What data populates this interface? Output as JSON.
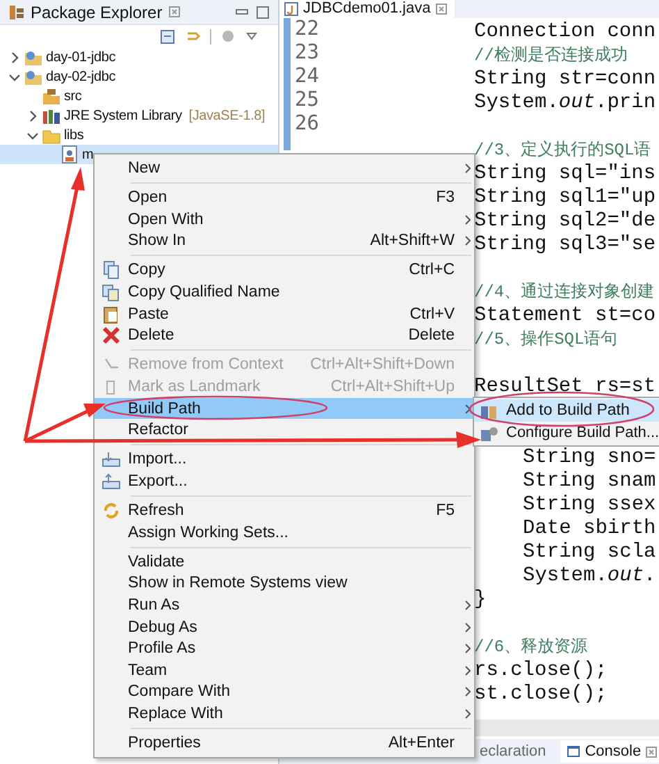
{
  "explorer": {
    "title": "Package Explorer",
    "tree": [
      {
        "label": "day-01-jdbc",
        "kind": "project",
        "expanded": false,
        "selected": false
      },
      {
        "label": "day-02-jdbc",
        "kind": "project",
        "expanded": true,
        "selected": false,
        "children": [
          {
            "label": "src",
            "kind": "source",
            "selected": false
          },
          {
            "label": "JRE System Library",
            "suffix": "[JavaSE-1.8]",
            "kind": "library",
            "expanded": false,
            "selected": false
          },
          {
            "label": "libs",
            "kind": "folder",
            "expanded": true,
            "selected": false,
            "children": [
              {
                "label": "m",
                "kind": "jar",
                "selected": true
              }
            ]
          }
        ]
      }
    ]
  },
  "editor": {
    "tab": "JDBCdemo01.java",
    "line_numbers": [
      "22",
      "23",
      "24",
      "25",
      "26"
    ],
    "lines": [
      {
        "kind": "code",
        "text": "Connection conn"
      },
      {
        "kind": "comment",
        "text": "//检测是否连接成功"
      },
      {
        "kind": "code",
        "text": "String str=conn"
      },
      {
        "kind": "code",
        "text": "System.*out*.prin"
      },
      {
        "kind": "blank"
      },
      {
        "kind": "comment",
        "text": "//3、定义执行的SQL语"
      },
      {
        "kind": "code",
        "text": "String sql=\"ins"
      },
      {
        "kind": "code",
        "text": "String sql1=\"up"
      },
      {
        "kind": "code",
        "text": "String sql2=\"de"
      },
      {
        "kind": "code",
        "text": "String sql3=\"se"
      },
      {
        "kind": "blank"
      },
      {
        "kind": "comment",
        "text": "//4、通过连接对象创建"
      },
      {
        "kind": "code",
        "text": "Statement st=co"
      },
      {
        "kind": "comment",
        "text": "//5、操作SQL语句"
      },
      {
        "kind": "blank"
      },
      {
        "kind": "code",
        "text": "ResultSet rs=st"
      },
      {
        "kind": "blank"
      },
      {
        "kind": "blank"
      },
      {
        "kind": "nested",
        "text": "String sno="
      },
      {
        "kind": "nested",
        "text": "String snam"
      },
      {
        "kind": "nested",
        "text": "String ssex"
      },
      {
        "kind": "nested",
        "text": "Date sbirth"
      },
      {
        "kind": "nested",
        "text": "String scla"
      },
      {
        "kind": "nested",
        "text": "System.*out*."
      },
      {
        "kind": "code",
        "text": "}"
      },
      {
        "kind": "blank"
      },
      {
        "kind": "comment",
        "text": "//6、释放资源"
      },
      {
        "kind": "code",
        "text": "rs.close();"
      },
      {
        "kind": "code",
        "text": "st.close();"
      }
    ]
  },
  "bottom_tabs": [
    {
      "label": "eclaration",
      "selected": false
    },
    {
      "label": "Console",
      "selected": true
    }
  ],
  "context_menu": {
    "groups": [
      {
        "items": [
          {
            "label": "New",
            "submenu": true,
            "disabled": false,
            "selected": false
          }
        ]
      },
      {
        "items": [
          {
            "label": "Open",
            "shortcut": "F3",
            "submenu": false,
            "disabled": false,
            "selected": false
          },
          {
            "label": "Open With",
            "submenu": true,
            "disabled": false,
            "selected": false
          },
          {
            "label": "Show In",
            "shortcut": "Alt+Shift+W",
            "submenu": true,
            "disabled": false,
            "selected": false
          }
        ]
      },
      {
        "items": [
          {
            "label": "Copy",
            "shortcut": "Ctrl+C",
            "submenu": false,
            "disabled": false,
            "selected": false
          },
          {
            "label": "Copy Qualified Name",
            "submenu": false,
            "disabled": false,
            "selected": false
          },
          {
            "label": "Paste",
            "shortcut": "Ctrl+V",
            "submenu": false,
            "disabled": false,
            "selected": false
          },
          {
            "label": "Delete",
            "shortcut": "Delete",
            "submenu": false,
            "disabled": false,
            "selected": false
          }
        ]
      },
      {
        "items": [
          {
            "label": "Remove from Context",
            "shortcut": "Ctrl+Alt+Shift+Down",
            "submenu": false,
            "disabled": true,
            "selected": false
          },
          {
            "label": "Mark as Landmark",
            "shortcut": "Ctrl+Alt+Shift+Up",
            "submenu": false,
            "disabled": true,
            "selected": false
          },
          {
            "label": "Build Path",
            "submenu": true,
            "disabled": false,
            "selected": true
          },
          {
            "label": "Refactor",
            "submenu": false,
            "disabled": false,
            "selected": false
          }
        ]
      },
      {
        "items": [
          {
            "label": "Import...",
            "submenu": false,
            "disabled": false,
            "selected": false
          },
          {
            "label": "Export...",
            "submenu": false,
            "disabled": false,
            "selected": false
          }
        ]
      },
      {
        "items": [
          {
            "label": "Refresh",
            "shortcut": "F5",
            "submenu": false,
            "disabled": false,
            "selected": false
          },
          {
            "label": "Assign Working Sets...",
            "submenu": false,
            "disabled": false,
            "selected": false
          }
        ]
      },
      {
        "items": [
          {
            "label": "Validate",
            "submenu": false,
            "disabled": false,
            "selected": false
          },
          {
            "label": "Show in Remote Systems view",
            "submenu": false,
            "disabled": false,
            "selected": false
          },
          {
            "label": "Run As",
            "submenu": true,
            "disabled": false,
            "selected": false
          },
          {
            "label": "Debug As",
            "submenu": true,
            "disabled": false,
            "selected": false
          },
          {
            "label": "Profile As",
            "submenu": true,
            "disabled": false,
            "selected": false
          },
          {
            "label": "Team",
            "submenu": true,
            "disabled": false,
            "selected": false
          },
          {
            "label": "Compare With",
            "submenu": true,
            "disabled": false,
            "selected": false
          },
          {
            "label": "Replace With",
            "submenu": true,
            "disabled": false,
            "selected": false
          }
        ]
      },
      {
        "items": [
          {
            "label": "Properties",
            "shortcut": "Alt+Enter",
            "submenu": false,
            "disabled": false,
            "selected": false
          }
        ]
      }
    ]
  },
  "submenu": {
    "items": [
      {
        "label": "Add to Build Path",
        "selected": true
      },
      {
        "label": "Configure Build Path...",
        "selected": false
      }
    ]
  }
}
